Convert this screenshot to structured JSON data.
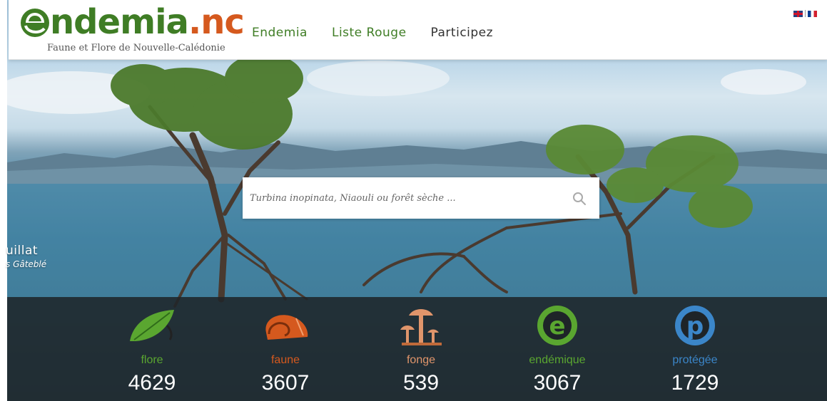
{
  "logo": {
    "word_main": "ndemia",
    "word_tld": ".nc",
    "tagline": "Faune et Flore de Nouvelle-Calédonie"
  },
  "nav": [
    "Endemia",
    "Liste Rouge",
    "Participez"
  ],
  "search": {
    "placeholder": "Turbina inopinata, Niaouli ou forêt sèche ..."
  },
  "credit": {
    "name": "uillat",
    "author": "s Gâteblé"
  },
  "stats": [
    {
      "label": "flore",
      "count": "4629",
      "color": "#5aa630",
      "icon": "leaf-icon"
    },
    {
      "label": "faune",
      "count": "3607",
      "color": "#d5591e",
      "icon": "shell-icon"
    },
    {
      "label": "fonge",
      "count": "539",
      "color": "#e0956b",
      "icon": "mushroom-icon"
    },
    {
      "label": "endémique",
      "count": "3067",
      "color": "#5aa630",
      "icon": "endemic-e-icon"
    },
    {
      "label": "protégée",
      "count": "1729",
      "color": "#3b86c9",
      "icon": "protected-p-icon"
    }
  ]
}
